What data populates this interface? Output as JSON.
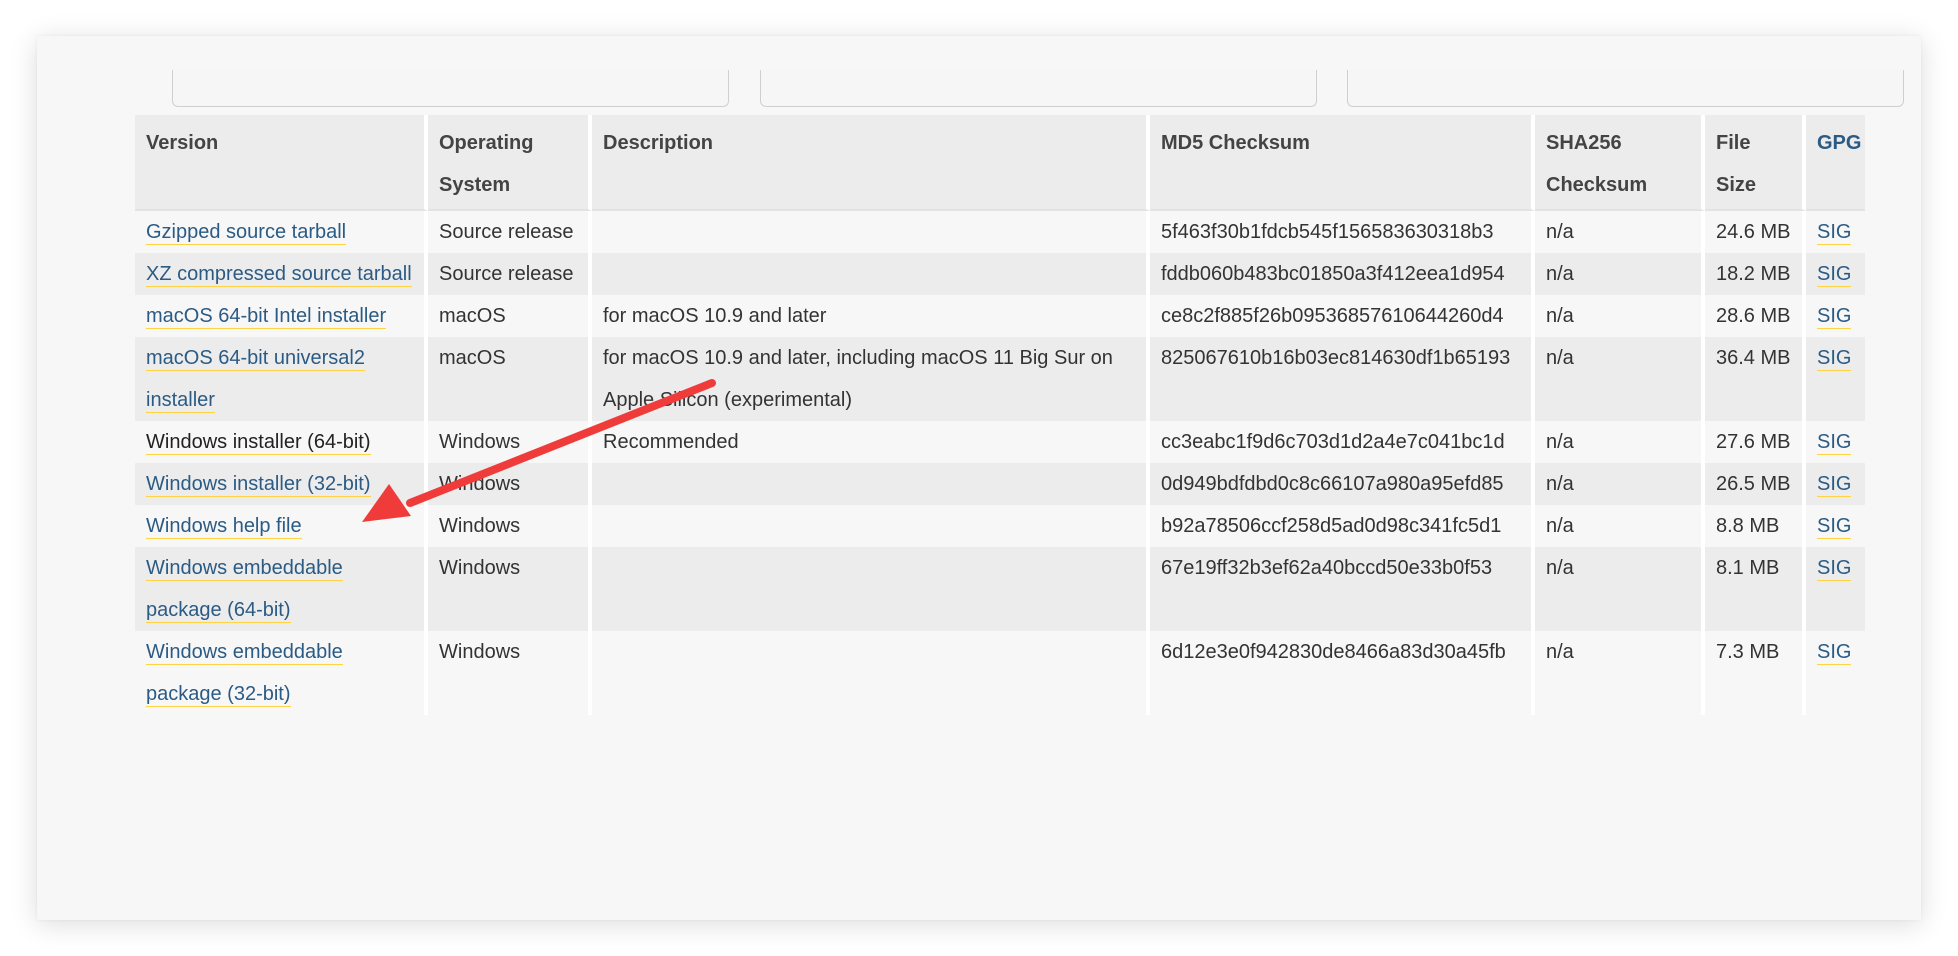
{
  "table": {
    "headers": {
      "version": "Version",
      "os": "Operating System",
      "description": "Description",
      "md5": "MD5 Checksum",
      "sha256": "SHA256 Checksum",
      "size": "File Size",
      "gpg": "GPG"
    },
    "rows": [
      {
        "version": "Gzipped source tarball",
        "os": "Source release",
        "description": "",
        "md5": "5f463f30b1fdcb545f156583630318b3",
        "sha256": "n/a",
        "size": "24.6 MB",
        "gpg": "SIG"
      },
      {
        "version": "XZ compressed source tarball",
        "os": "Source release",
        "description": "",
        "md5": "fddb060b483bc01850a3f412eea1d954",
        "sha256": "n/a",
        "size": "18.2 MB",
        "gpg": "SIG"
      },
      {
        "version": "macOS 64-bit Intel installer",
        "os": "macOS",
        "description": "for macOS 10.9 and later",
        "md5": "ce8c2f885f26b09536857610644260d4",
        "sha256": "n/a",
        "size": "28.6 MB",
        "gpg": "SIG"
      },
      {
        "version": "macOS 64-bit universal2 installer",
        "os": "macOS",
        "description": "for macOS 10.9 and later, including macOS 11 Big Sur on Apple Silicon (experimental)",
        "md5": "825067610b16b03ec814630df1b65193",
        "sha256": "n/a",
        "size": "36.4 MB",
        "gpg": "SIG"
      },
      {
        "version": "Windows installer (64-bit)",
        "os": "Windows",
        "description": "Recommended",
        "md5": "cc3eabc1f9d6c703d1d2a4e7c041bc1d",
        "sha256": "n/a",
        "size": "27.6 MB",
        "gpg": "SIG"
      },
      {
        "version": "Windows installer (32-bit)",
        "os": "Windows",
        "description": "",
        "md5": "0d949bdfdbd0c8c66107a980a95efd85",
        "sha256": "n/a",
        "size": "26.5 MB",
        "gpg": "SIG"
      },
      {
        "version": "Windows help file",
        "os": "Windows",
        "description": "",
        "md5": "b92a78506ccf258d5ad0d98c341fc5d1",
        "sha256": "n/a",
        "size": "8.8 MB",
        "gpg": "SIG"
      },
      {
        "version": "Windows embeddable package (64-bit)",
        "os": "Windows",
        "description": "",
        "md5": "67e19ff32b3ef62a40bccd50e33b0f53",
        "sha256": "n/a",
        "size": "8.1 MB",
        "gpg": "SIG"
      },
      {
        "version": "Windows embeddable package (32-bit)",
        "os": "Windows",
        "description": "",
        "md5": "6d12e3e0f942830de8466a83d30a45fb",
        "sha256": "n/a",
        "size": "7.3 MB",
        "gpg": "SIG"
      }
    ]
  },
  "colors": {
    "link": "#2b5b84",
    "link_underline": "#ffd343",
    "annotation_arrow": "#f03b3b"
  }
}
